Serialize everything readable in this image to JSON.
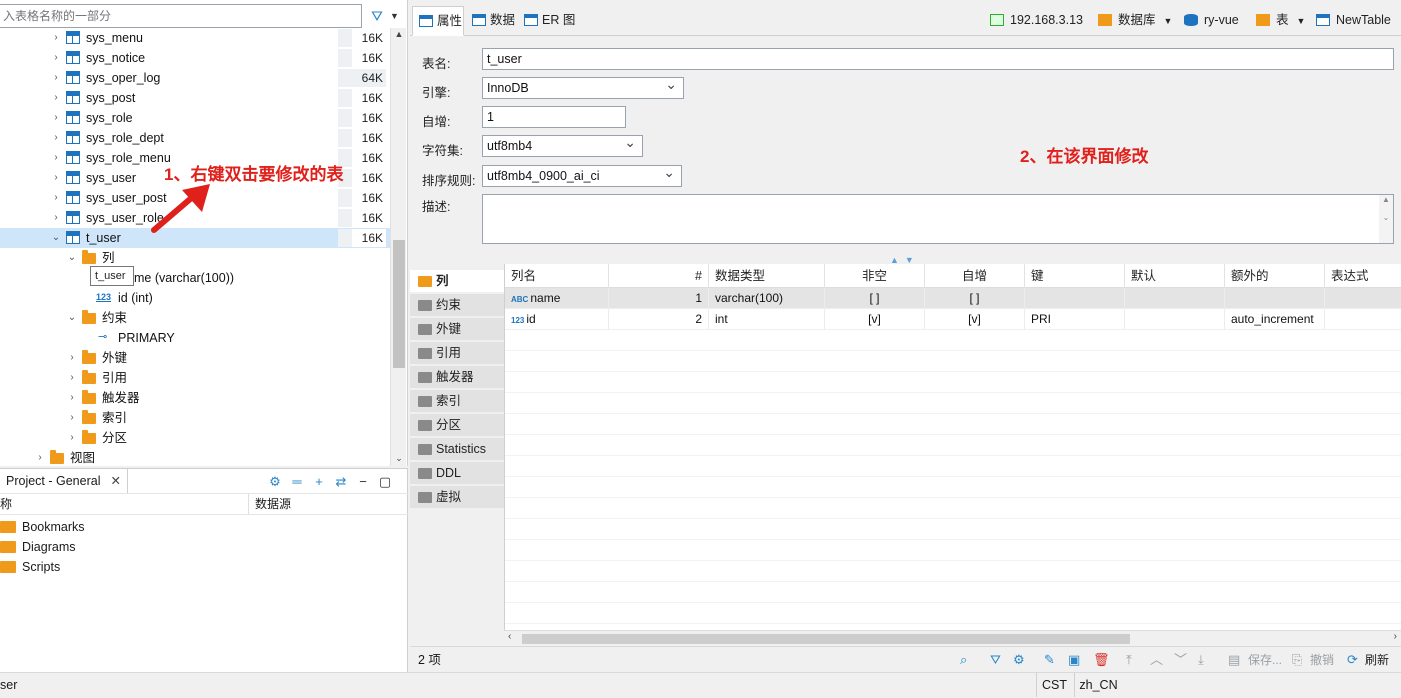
{
  "navigator": {
    "filter_placeholder": "入表格名称的一部分",
    "tables": [
      {
        "name": "sys_menu",
        "size": "16K"
      },
      {
        "name": "sys_notice",
        "size": "16K"
      },
      {
        "name": "sys_oper_log",
        "size": "64K"
      },
      {
        "name": "sys_post",
        "size": "16K"
      },
      {
        "name": "sys_role",
        "size": "16K"
      },
      {
        "name": "sys_role_dept",
        "size": "16K"
      },
      {
        "name": "sys_role_menu",
        "size": "16K"
      },
      {
        "name": "sys_user",
        "size": "16K"
      },
      {
        "name": "sys_user_post",
        "size": "16K"
      },
      {
        "name": "sys_user_role",
        "size": "16K"
      },
      {
        "name": "t_user",
        "size": "16K"
      }
    ],
    "columns_folder": "列",
    "column_name": "name (varchar(100))",
    "column_name_visible": "me (varchar(100))",
    "column_id": "id (int)",
    "constraints_folder": "约束",
    "primary": "PRIMARY",
    "foreign_keys": "外键",
    "references": "引用",
    "triggers": "触发器",
    "indexes": "索引",
    "partitions": "分区",
    "views": "视图",
    "tooltip": "t_user"
  },
  "annotation1": "1、右键双击要修改的表",
  "annotation2": "2、在该界面修改",
  "project": {
    "tab": "Project - General",
    "col_name": "称",
    "col_source": "数据源",
    "items": [
      "Bookmarks",
      "Diagrams",
      "Scripts"
    ]
  },
  "status": {
    "left": "ser",
    "tz": "CST",
    "locale": "zh_CN"
  },
  "editor": {
    "tabs": [
      "属性",
      "数据",
      "ER 图"
    ],
    "context": {
      "server": "192.168.3.13",
      "database_label": "数据库",
      "schema": "ry-vue",
      "table_label": "表",
      "table": "NewTable"
    },
    "props": {
      "name_label": "表名:",
      "name_value": "t_user",
      "engine_label": "引擎:",
      "engine_value": "InnoDB",
      "autoinc_label": "自增:",
      "autoinc_value": "1",
      "charset_label": "字符集:",
      "charset_value": "utf8mb4",
      "collation_label": "排序规则:",
      "collation_value": "utf8mb4_0900_ai_ci",
      "desc_label": "描述:"
    },
    "side_tabs": [
      "列",
      "约束",
      "外键",
      "引用",
      "触发器",
      "索引",
      "分区",
      "Statistics",
      "DDL",
      "虚拟"
    ],
    "grid": {
      "headers": [
        "列名",
        "#",
        "数据类型",
        "非空",
        "自增",
        "键",
        "默认",
        "额外的",
        "表达式"
      ],
      "rows": [
        {
          "type_icon": "ABC",
          "name": "name",
          "num": "1",
          "dtype": "varchar(100)",
          "notnull": "[ ]",
          "autoinc": "[ ]",
          "key": "",
          "default": "",
          "extra": "",
          "expr": ""
        },
        {
          "type_icon": "123",
          "name": "id",
          "num": "2",
          "dtype": "int",
          "notnull": "[v]",
          "autoinc": "[v]",
          "key": "PRI",
          "default": "",
          "extra": "auto_increment",
          "expr": ""
        }
      ]
    },
    "footer": {
      "count": "2 项",
      "save": "保存...",
      "revert": "撤销",
      "refresh": "刷新"
    }
  },
  "colors": {
    "accent": "#1e73be",
    "folder": "#f09a1c",
    "annotation": "#e0201b",
    "selection": "#cfe6fa"
  }
}
